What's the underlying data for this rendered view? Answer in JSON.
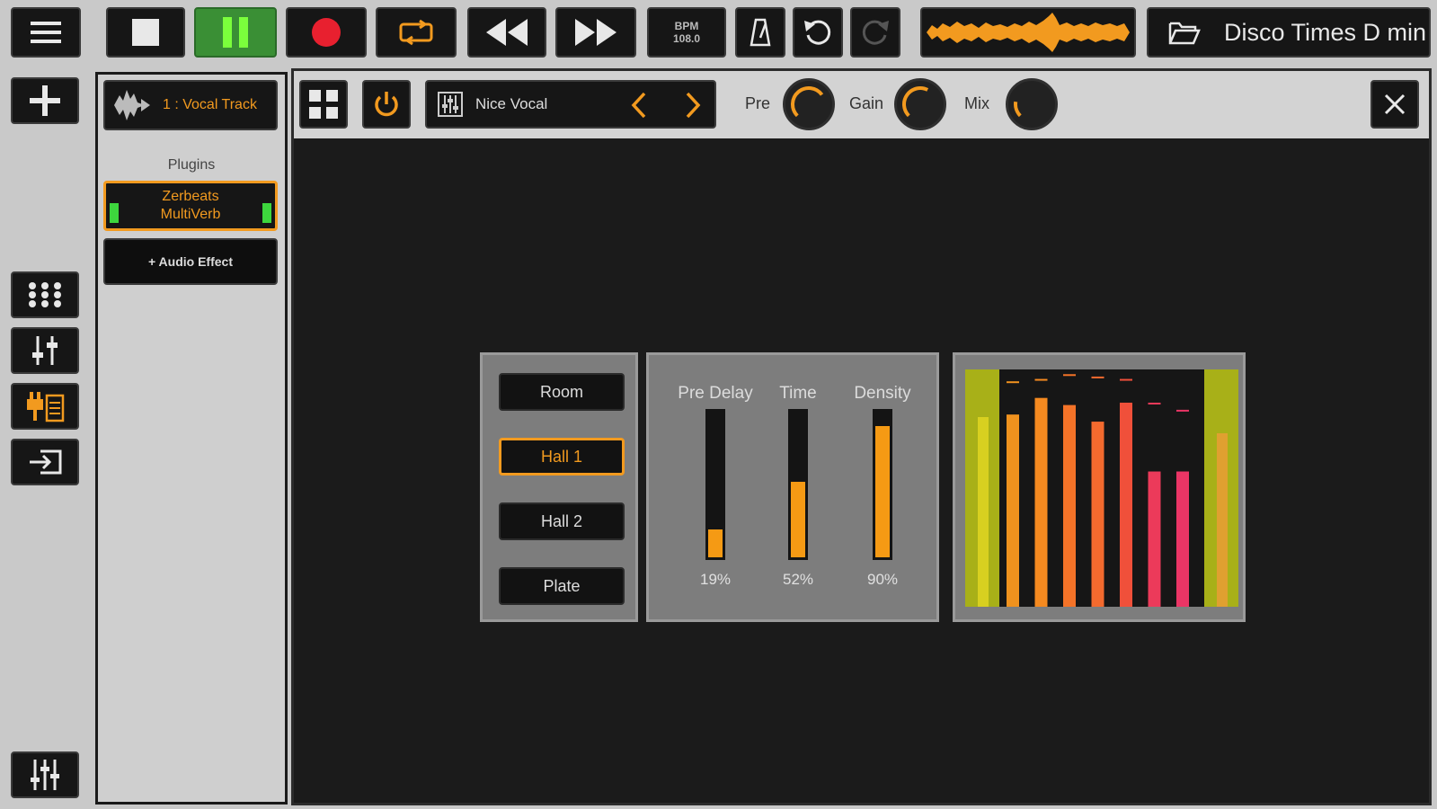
{
  "project": {
    "name": "Disco Times D min"
  },
  "transport": {
    "bpm_label": "BPM",
    "bpm_value": "108.0"
  },
  "track": {
    "name": "1 : Vocal Track"
  },
  "plugins": {
    "heading": "Plugins",
    "items": [
      {
        "line1": "Zerbeats",
        "line2": "MultiVerb"
      }
    ],
    "add_label": "+ Audio Effect"
  },
  "editor": {
    "preset_name": "Nice Vocal",
    "knobs": [
      {
        "label": "Pre",
        "level": 0.7
      },
      {
        "label": "Gain",
        "level": 0.6
      },
      {
        "label": "Mix",
        "level": 0.2
      }
    ],
    "presets": [
      "Room",
      "Hall 1",
      "Hall 2",
      "Plate"
    ],
    "active_preset": "Hall 1",
    "sliders": [
      {
        "label": "Pre Delay",
        "value": 19,
        "display": "19%"
      },
      {
        "label": "Time",
        "value": 52,
        "display": "52%"
      },
      {
        "label": "Density",
        "value": 90,
        "display": "90%"
      }
    ],
    "meter": {
      "input_level": 0.8,
      "output_level": 0.73,
      "bars": [
        {
          "level": 0.81,
          "peak": 0.95,
          "color": "#f0921e"
        },
        {
          "level": 0.88,
          "peak": 0.96,
          "color": "#f58a20"
        },
        {
          "level": 0.85,
          "peak": 0.98,
          "color": "#f47328"
        },
        {
          "level": 0.78,
          "peak": 0.97,
          "color": "#f36a2e"
        },
        {
          "level": 0.86,
          "peak": 0.96,
          "color": "#f0503a"
        },
        {
          "level": 0.57,
          "peak": 0.86,
          "color": "#ec3a5a"
        },
        {
          "level": 0.57,
          "peak": 0.83,
          "color": "#ea3565"
        }
      ]
    }
  },
  "colors": {
    "accent": "#f29a1f",
    "record": "#e8202f",
    "play_active": "#3a8f35",
    "play_icon": "#7bff3c",
    "meter_level": "#c8d016"
  }
}
